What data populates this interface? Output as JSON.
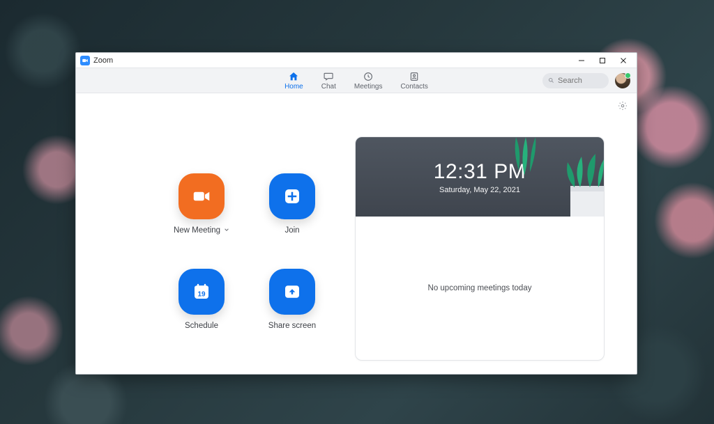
{
  "app": {
    "title": "Zoom"
  },
  "nav": {
    "tabs": [
      {
        "label": "Home",
        "active": true
      },
      {
        "label": "Chat",
        "active": false
      },
      {
        "label": "Meetings",
        "active": false
      },
      {
        "label": "Contacts",
        "active": false
      }
    ]
  },
  "search": {
    "placeholder": "Search"
  },
  "home": {
    "actions": {
      "new_meeting": {
        "label": "New Meeting"
      },
      "join": {
        "label": "Join"
      },
      "schedule": {
        "label": "Schedule",
        "day_number": "19"
      },
      "share_screen": {
        "label": "Share screen"
      }
    },
    "panel": {
      "time": "12:31 PM",
      "date": "Saturday, May 22, 2021",
      "empty_message": "No upcoming meetings today"
    }
  },
  "colors": {
    "brand_blue": "#0E71EB",
    "brand_orange": "#F26D21"
  }
}
